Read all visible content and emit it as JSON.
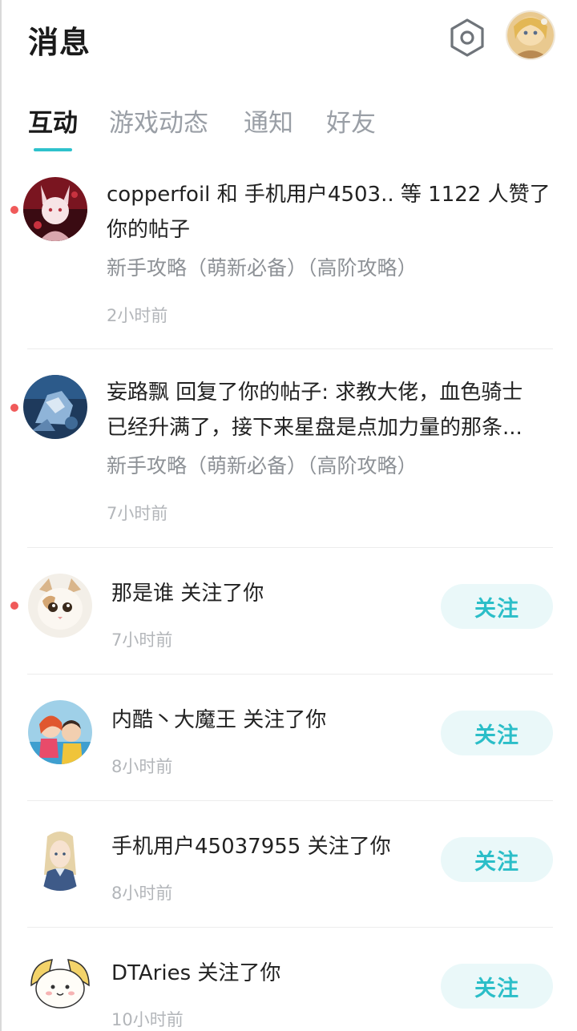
{
  "header": {
    "title": "消息",
    "settings_icon": "hexagon-gear-icon",
    "avatar": "profile-avatar"
  },
  "tabs": [
    {
      "label": "互动",
      "active": true
    },
    {
      "label": "游戏动态",
      "active": false
    },
    {
      "label": "通知",
      "active": false
    },
    {
      "label": "好友",
      "active": false
    }
  ],
  "accent_color": "#2ec2cc",
  "unread_color": "#f05a5a",
  "interactions": [
    {
      "line1": "copperfoil 和 手机用户4503.. 等 1122 人赞了",
      "line2": "你的帖子",
      "tags": "新手攻略（萌新必备）（高阶攻略）",
      "time": "2小时前",
      "unread": true
    },
    {
      "line1": "妄路飘 回复了你的帖子: 求教大佬，血色骑士",
      "line2": "已经升满了，接下来星盘是点加力量的那条...",
      "tags": "新手攻略（萌新必备）（高阶攻略）",
      "time": "7小时前",
      "unread": true
    }
  ],
  "follows": [
    {
      "text": "那是谁 关注了你",
      "time": "7小时前",
      "button": "关注",
      "unread": true
    },
    {
      "text": "内酷丶大魔王 关注了你",
      "time": "8小时前",
      "button": "关注",
      "unread": false
    },
    {
      "text": "手机用户45037955 关注了你",
      "time": "8小时前",
      "button": "关注",
      "unread": false
    },
    {
      "text": "DTAries 关注了你",
      "time": "10小时前",
      "button": "关注",
      "unread": false
    }
  ]
}
